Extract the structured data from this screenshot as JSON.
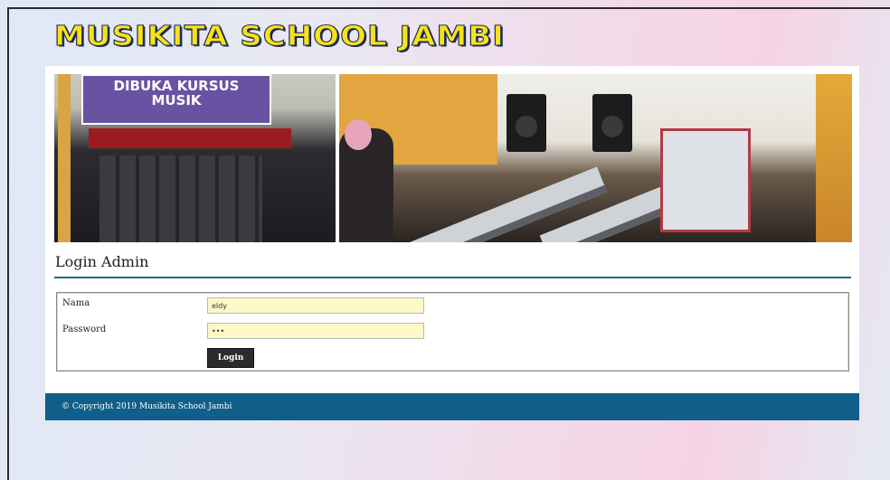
{
  "header": {
    "site_title": "MUSIKITA SCHOOL JAMBI"
  },
  "banner": {
    "sign_text_1": "DIBUKA KURSUS",
    "sign_text_2": "MUSIK"
  },
  "login": {
    "title": "Login Admin",
    "name_label": "Nama",
    "name_value": "eldy",
    "password_label": "Password",
    "password_value": "•••",
    "submit_label": "Login"
  },
  "footer": {
    "copyright": "© Copyright 2019 Musikita School Jambi"
  },
  "colors": {
    "title_yellow": "#f7e21a",
    "accent_teal": "#1c6a86",
    "footer_blue": "#0f5f8a",
    "input_yellow": "#fdf8c8"
  }
}
